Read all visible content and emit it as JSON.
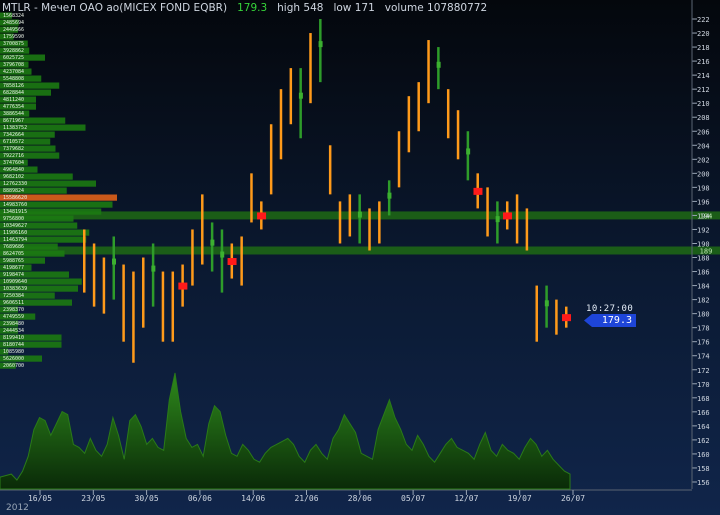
{
  "header": {
    "title": "MTLR - Мечел ОАО ао(MICEX FOND EQBR)",
    "price": "179.3",
    "high": "high 548",
    "low": "low 171",
    "volume": "volume 107880772"
  },
  "tag": {
    "time": "10:27:00",
    "price": "179.3"
  },
  "year_label": "2012",
  "colors": {
    "up": "#2e9c2a",
    "down": "#ff9a1a",
    "signal": "#ff1a1a",
    "volume": "#1f7a12",
    "level": "#1f6a14",
    "axis": "#9aa6b6"
  },
  "chart_data": {
    "type": "bar",
    "title": "MTLR - Мечел ОАО ао(MICEX FOND EQBR)",
    "ylim": [
      155,
      223
    ],
    "y_ticks": [
      156,
      158,
      160,
      162,
      164,
      166,
      168,
      170,
      172,
      174,
      176,
      178,
      180,
      182,
      184,
      186,
      188,
      190,
      192,
      194,
      196,
      198,
      200,
      202,
      204,
      206,
      208,
      210,
      212,
      214,
      216,
      218,
      220,
      222
    ],
    "x_ticks": [
      "16/05",
      "23/05",
      "30/05",
      "06/06",
      "14/06",
      "21/06",
      "28/06",
      "05/07",
      "12/07",
      "19/07",
      "26/07"
    ],
    "levels": [
      {
        "price": 194,
        "label": "194"
      },
      {
        "price": 189,
        "label": "189"
      }
    ],
    "volume_profile": {
      "ticks": [
        "1568324",
        "2485694",
        "2449566",
        "1759590",
        "3700875",
        "3928862",
        "6025725",
        "3796708",
        "4237084",
        "5548808",
        "7858126",
        "6828844",
        "4811240",
        "4776354",
        "3886544",
        "8671967",
        "11383752",
        "7342664",
        "6710572",
        "7379682",
        "7922716",
        "3747604",
        "4964840",
        "9682102",
        "12762330",
        "8889824",
        "15586620",
        "14983760",
        "13481915",
        "9756800",
        "10349627",
        "11906160",
        "11463794",
        "7689686",
        "8624705",
        "5988765",
        "4198677",
        "9198474",
        "10909640",
        "10383639",
        "7250384",
        "9606511",
        "2398370",
        "4749559",
        "2398480",
        "2444534",
        "8199410",
        "8180744",
        "1085980",
        "5626000",
        "2060700"
      ],
      "values": [
        1.6,
        2.5,
        2.4,
        1.8,
        3.7,
        3.9,
        6.0,
        3.8,
        4.2,
        5.5,
        7.9,
        6.8,
        4.8,
        4.8,
        3.9,
        8.7,
        11.4,
        7.3,
        6.7,
        7.4,
        7.9,
        3.7,
        5.0,
        9.7,
        12.8,
        8.9,
        15.6,
        15.0,
        13.5,
        9.8,
        10.3,
        11.9,
        11.5,
        7.7,
        8.6,
        6.0,
        4.2,
        9.2,
        10.9,
        10.4,
        7.3,
        9.6,
        2.4,
        4.7,
        2.4,
        2.4,
        8.2,
        8.2,
        1.1,
        5.6,
        2.1
      ]
    },
    "candles": [
      {
        "x": "22/05",
        "high": 192,
        "low": 183,
        "color": "down"
      },
      {
        "x": "23/05",
        "high": 190,
        "low": 181,
        "color": "down"
      },
      {
        "x": "24/05",
        "high": 188,
        "low": 180,
        "color": "down"
      },
      {
        "x": "25/05",
        "high": 191,
        "low": 182,
        "color": "up"
      },
      {
        "x": "28/05",
        "high": 187,
        "low": 176,
        "color": "down"
      },
      {
        "x": "29/05",
        "high": 186,
        "low": 173,
        "color": "down"
      },
      {
        "x": "30/05",
        "high": 188,
        "low": 178,
        "color": "down"
      },
      {
        "x": "01/06",
        "high": 190,
        "low": 181,
        "color": "up"
      },
      {
        "x": "04/06",
        "high": 186,
        "low": 176,
        "color": "down"
      },
      {
        "x": "05/06",
        "high": 186,
        "low": 176,
        "color": "down"
      },
      {
        "x": "06/06",
        "high": 187,
        "low": 181,
        "color": "signal"
      },
      {
        "x": "07/06",
        "high": 192,
        "low": 184,
        "color": "down"
      },
      {
        "x": "08/06",
        "high": 197,
        "low": 187,
        "color": "down"
      },
      {
        "x": "11/06",
        "high": 193,
        "low": 186,
        "color": "up"
      },
      {
        "x": "13/06",
        "high": 192,
        "low": 183,
        "color": "up"
      },
      {
        "x": "14/06",
        "high": 190,
        "low": 185,
        "color": "signal"
      },
      {
        "x": "15/06",
        "high": 191,
        "low": 184,
        "color": "down"
      },
      {
        "x": "18/06",
        "high": 200,
        "low": 193,
        "color": "down"
      },
      {
        "x": "18/06b",
        "high": 196,
        "low": 192,
        "color": "signal"
      },
      {
        "x": "19/06",
        "high": 207,
        "low": 197,
        "color": "down"
      },
      {
        "x": "20/06",
        "high": 212,
        "low": 202,
        "color": "down"
      },
      {
        "x": "21/06",
        "high": 215,
        "low": 207,
        "color": "down"
      },
      {
        "x": "22/06",
        "high": 215,
        "low": 205,
        "color": "up"
      },
      {
        "x": "25/06",
        "high": 220,
        "low": 210,
        "color": "down"
      },
      {
        "x": "25/06b",
        "high": 222,
        "low": 213,
        "color": "up"
      },
      {
        "x": "26/06",
        "high": 204,
        "low": 197,
        "color": "down"
      },
      {
        "x": "27/06",
        "high": 196,
        "low": 190,
        "color": "down"
      },
      {
        "x": "28/06",
        "high": 197,
        "low": 191,
        "color": "down"
      },
      {
        "x": "29/06",
        "high": 197,
        "low": 190,
        "color": "up"
      },
      {
        "x": "02/07",
        "high": 195,
        "low": 189,
        "color": "down"
      },
      {
        "x": "03/07",
        "high": 196,
        "low": 190,
        "color": "down"
      },
      {
        "x": "04/07",
        "high": 199,
        "low": 194,
        "color": "up"
      },
      {
        "x": "05/07",
        "high": 206,
        "low": 198,
        "color": "down"
      },
      {
        "x": "06/07",
        "high": 211,
        "low": 203,
        "color": "down"
      },
      {
        "x": "09/07",
        "high": 213,
        "low": 206,
        "color": "down"
      },
      {
        "x": "10/07",
        "high": 219,
        "low": 210,
        "color": "down"
      },
      {
        "x": "10/07b",
        "high": 218,
        "low": 212,
        "color": "up"
      },
      {
        "x": "11/07",
        "high": 212,
        "low": 205,
        "color": "down"
      },
      {
        "x": "12/07",
        "high": 209,
        "low": 202,
        "color": "down"
      },
      {
        "x": "13/07",
        "high": 206,
        "low": 199,
        "color": "up"
      },
      {
        "x": "16/07",
        "high": 200,
        "low": 195,
        "color": "signal"
      },
      {
        "x": "17/07",
        "high": 198,
        "low": 191,
        "color": "down"
      },
      {
        "x": "18/07",
        "high": 196,
        "low": 190,
        "color": "up"
      },
      {
        "x": "19/07",
        "high": 196,
        "low": 192,
        "color": "signal"
      },
      {
        "x": "20/07",
        "high": 197,
        "low": 190,
        "color": "down"
      },
      {
        "x": "23/07",
        "high": 195,
        "low": 189,
        "color": "down"
      },
      {
        "x": "24/07",
        "high": 184,
        "low": 176,
        "color": "down"
      },
      {
        "x": "25/07",
        "high": 184,
        "low": 178,
        "color": "up"
      },
      {
        "x": "26/07",
        "high": 182,
        "low": 177,
        "color": "down"
      },
      {
        "x": "26/07b",
        "high": 181,
        "low": 178,
        "color": "signal"
      }
    ],
    "volume": [
      8,
      9,
      10,
      6,
      12,
      22,
      40,
      48,
      46,
      36,
      44,
      52,
      50,
      30,
      28,
      24,
      34,
      26,
      22,
      30,
      48,
      36,
      20,
      46,
      50,
      42,
      30,
      34,
      28,
      26,
      60,
      78,
      52,
      34,
      28,
      30,
      22,
      44,
      56,
      52,
      36,
      24,
      22,
      30,
      26,
      20,
      18,
      24,
      28,
      30,
      32,
      34,
      30,
      22,
      18,
      26,
      30,
      24,
      20,
      34,
      40,
      50,
      44,
      38,
      24,
      22,
      20,
      40,
      50,
      60,
      48,
      40,
      30,
      26,
      36,
      30,
      22,
      18,
      24,
      30,
      34,
      28,
      26,
      24,
      20,
      30,
      38,
      26,
      22,
      30,
      26,
      24,
      20,
      28,
      34,
      30,
      22,
      26,
      20,
      16,
      12,
      10
    ]
  }
}
